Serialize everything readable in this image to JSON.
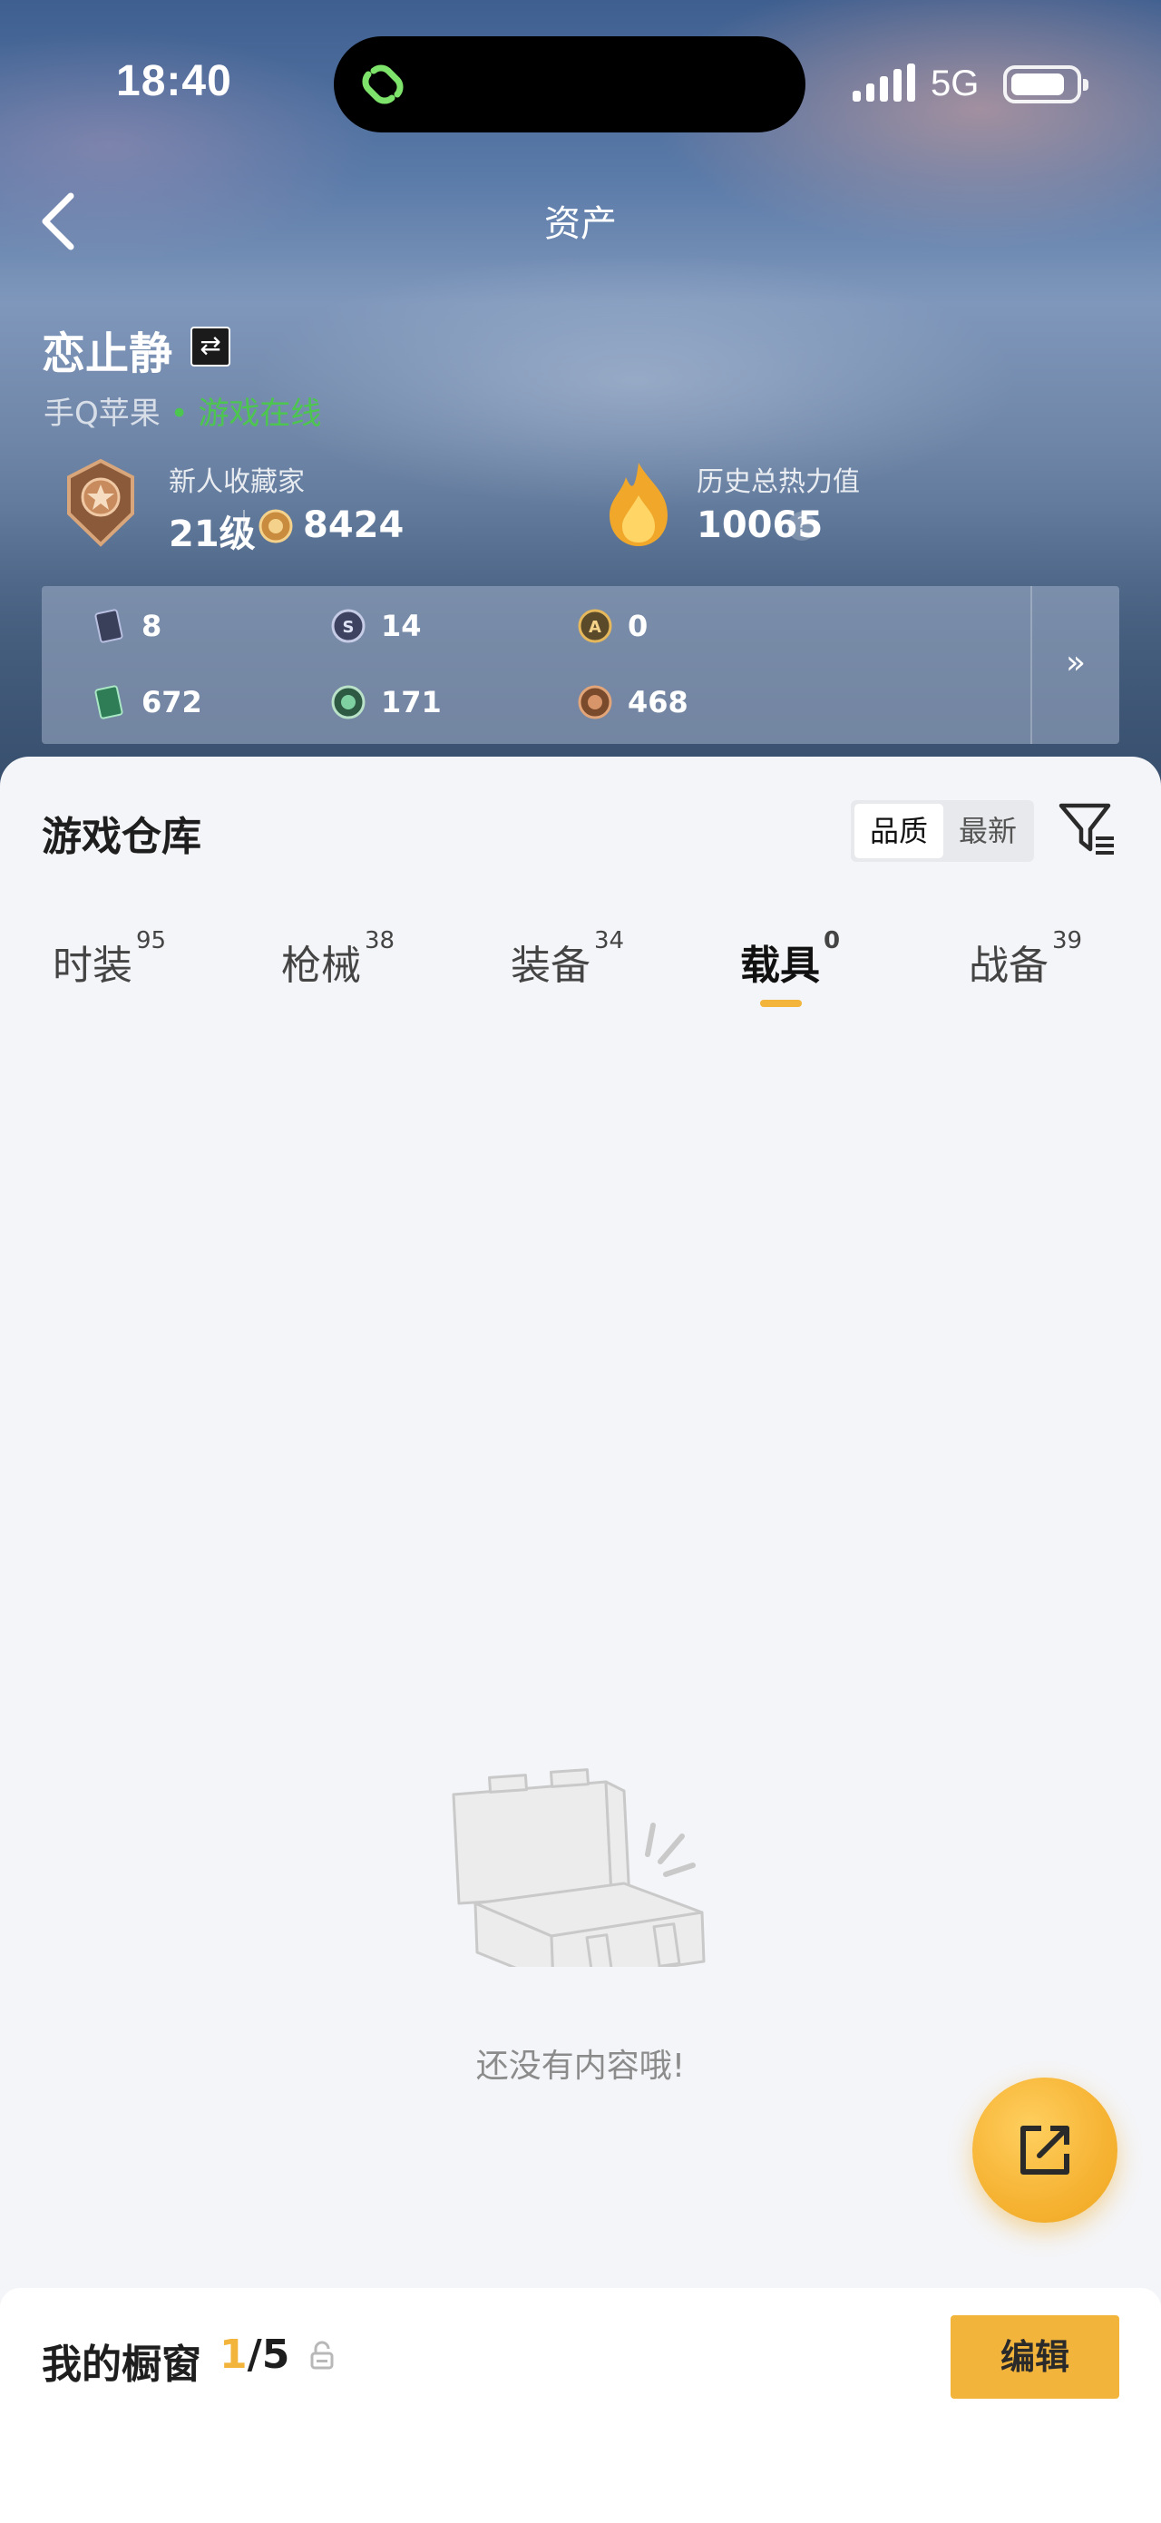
{
  "status_bar": {
    "time": "18:40",
    "network": "5G",
    "icons": [
      "app-link-icon",
      "signal-icon",
      "battery-icon"
    ]
  },
  "nav": {
    "title": "资产",
    "back_icon": "chevron-left-icon"
  },
  "user": {
    "name": "恋止静",
    "switch_icon": "swap-icon",
    "platform": "手Q苹果",
    "separator": " • ",
    "online_status": "游戏在线"
  },
  "collector": {
    "title": "新人收藏家",
    "level": "21级",
    "points": "8424"
  },
  "heat": {
    "title": "历史总热力值",
    "value": "10065",
    "help_icon": "?"
  },
  "currencies": [
    {
      "icon": "card-icon",
      "value": "8"
    },
    {
      "icon": "coin-s-icon",
      "value": "14"
    },
    {
      "icon": "coin-a-icon",
      "value": "0"
    },
    {
      "icon": "ticket-icon",
      "value": "672"
    },
    {
      "icon": "green-orb-icon",
      "value": "171"
    },
    {
      "icon": "bronze-medal-icon",
      "value": "468"
    }
  ],
  "more_icon": "»",
  "warehouse": {
    "title": "游戏仓库",
    "sort_options": [
      "品质",
      "最新"
    ],
    "selected_sort": "品质",
    "tabs": [
      {
        "label": "时装",
        "count": "95"
      },
      {
        "label": "枪械",
        "count": "38"
      },
      {
        "label": "装备",
        "count": "34"
      },
      {
        "label": "载具",
        "count": "0"
      },
      {
        "label": "战备",
        "count": "39"
      }
    ],
    "active_tab": "载具",
    "empty_text": "还没有内容哦!"
  },
  "showcase": {
    "title": "我的橱窗",
    "current": "1",
    "total": "/5",
    "edit_label": "编辑"
  },
  "colors": {
    "accent": "#f2b43a",
    "online": "#4cc64f",
    "sheet_bg": "#f4f5f8"
  }
}
